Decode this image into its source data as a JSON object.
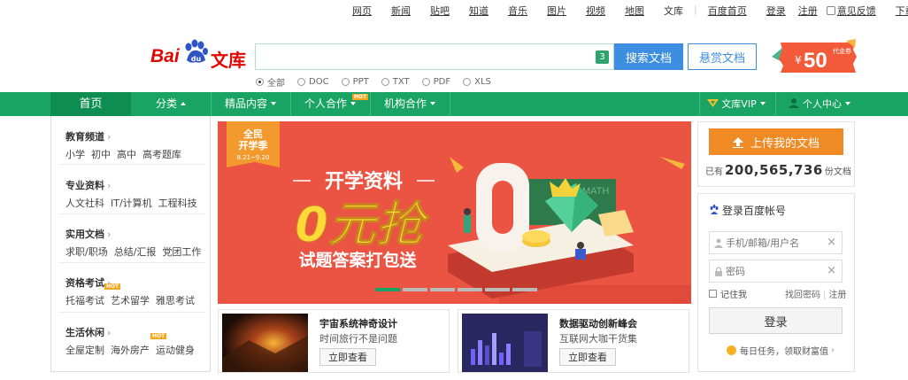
{
  "top_links": [
    "网页",
    "新闻",
    "贴吧",
    "知道",
    "音乐",
    "图片",
    "视频",
    "地图",
    "文库"
  ],
  "top_right": {
    "baidu_home": "百度首页",
    "login": "登录",
    "register": "注册",
    "feedback": "意见反馈",
    "download": "下载客户端"
  },
  "logo": {
    "bai": "Bai",
    "du": "du",
    "wenku": "文库"
  },
  "search": {
    "placeholder": "",
    "badge": "3",
    "search_button": "搜索文档",
    "reward_button": "悬赏文档"
  },
  "promo": {
    "symbol": "¥",
    "amount": "50",
    "label": "代金券"
  },
  "file_types": [
    "全部",
    "DOC",
    "PPT",
    "TXT",
    "PDF",
    "XLS"
  ],
  "nav": {
    "home": "首页",
    "category": "分类",
    "premium": "精品内容",
    "personal": "个人合作",
    "org": "机构合作",
    "hot": "HOT",
    "vip": "文库VIP",
    "user_center": "个人中心"
  },
  "sidebar": [
    {
      "title": "教育频道",
      "links": [
        "小学",
        "初中",
        "高中",
        "高考题库"
      ]
    },
    {
      "title": "专业资料",
      "links": [
        "人文社科",
        "IT/计算机",
        "工程科技"
      ]
    },
    {
      "title": "实用文档",
      "links": [
        "求职/职场",
        "总结/汇报",
        "党团工作"
      ]
    },
    {
      "title": "资格考试",
      "links": [
        "托福考试",
        "艺术留学",
        "雅思考试"
      ]
    },
    {
      "title": "生活休闲",
      "links": [
        "全屋定制",
        "海外房产",
        "运动健身"
      ]
    }
  ],
  "banner": {
    "badge_line1": "全民",
    "badge_line2": "开学季",
    "badge_date": "8.21~9.20",
    "headline": "开学资料",
    "big": "0元抢",
    "sub": "试题答案打包送",
    "board": "MATH"
  },
  "cards": [
    {
      "title": "宇宙系统神奇设计",
      "subtitle": "时间旅行不是问题",
      "button": "立即查看"
    },
    {
      "title": "数据驱动创新峰会",
      "subtitle": "互联网大咖干货集",
      "button": "立即查看"
    }
  ],
  "upload": {
    "button": "上传我的文档",
    "prefix": "已有",
    "count": "200,565,736",
    "suffix": "份文档"
  },
  "login": {
    "title": "登录百度帐号",
    "username_placeholder": "手机/邮箱/用户名",
    "password_placeholder": "密码",
    "remember": "记住我",
    "forgot": "找回密码",
    "register": "注册",
    "button": "登录",
    "daily": "每日任务，领取财富值"
  },
  "colors": {
    "green": "#19a463",
    "blue": "#3d8de0",
    "orange": "#f08a24",
    "banner_red": "#eb5443"
  }
}
